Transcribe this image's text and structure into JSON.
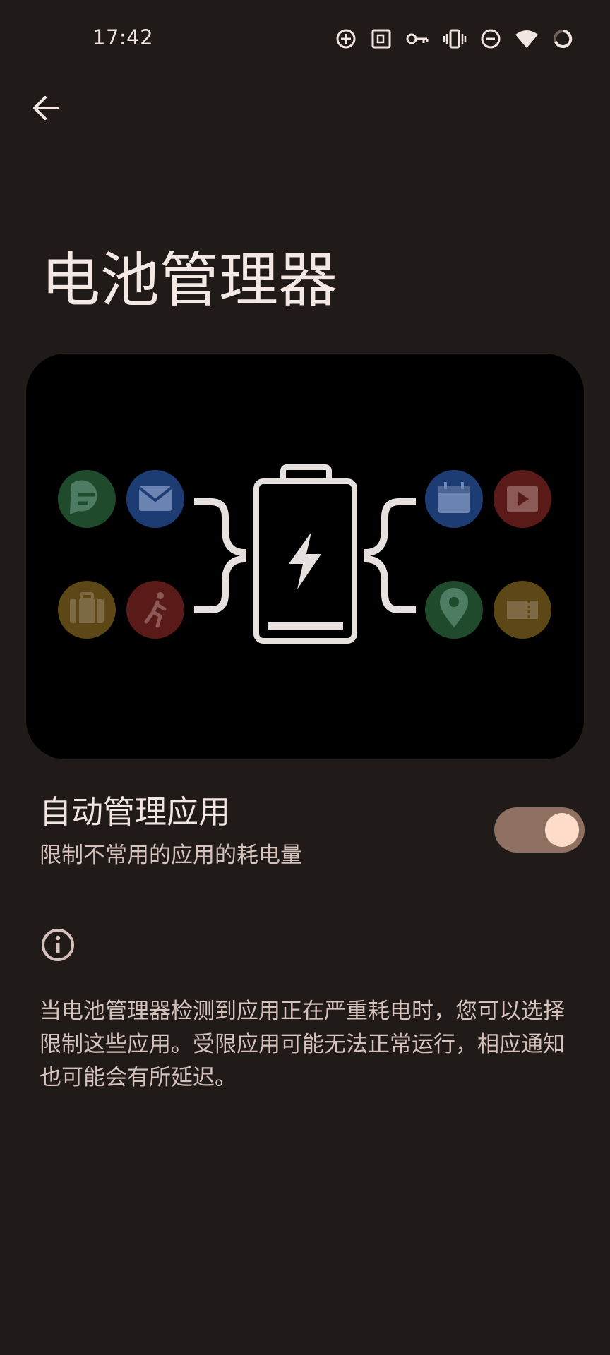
{
  "status_bar": {
    "time": "17:42",
    "icons": [
      "add-circle-icon",
      "nfc-frame-icon",
      "vpn-key-icon",
      "vibrate-icon",
      "do-not-disturb-icon",
      "wifi-icon",
      "battery-ring-icon"
    ]
  },
  "app_bar": {
    "back_icon": "arrow-back-icon"
  },
  "page": {
    "title": "电池管理器"
  },
  "illustration": {
    "left_icons": [
      "messaging-icon",
      "mail-icon",
      "work-bag-icon",
      "fitness-icon"
    ],
    "right_icons": [
      "calendar-icon",
      "video-icon",
      "maps-pin-icon",
      "ticket-icon"
    ],
    "center_icon": "battery-bolt-icon"
  },
  "setting": {
    "title": "自动管理应用",
    "summary": "限制不常用的应用的耗电量",
    "enabled": true
  },
  "footer": {
    "info_icon": "info-icon",
    "text": "当电池管理器检测到应用正在严重耗电时，您可以选择限制这些应用。受限应用可能无法正常运行，相应通知也可能会有所延迟。"
  },
  "colors": {
    "background": "#201a18",
    "card": "#000000",
    "switch_track": "#8e7161",
    "switch_thumb": "#ffdbc9",
    "green": "#1f4a2c",
    "blue": "#1d3c74",
    "amber": "#5e4716",
    "red": "#5a1a17"
  }
}
